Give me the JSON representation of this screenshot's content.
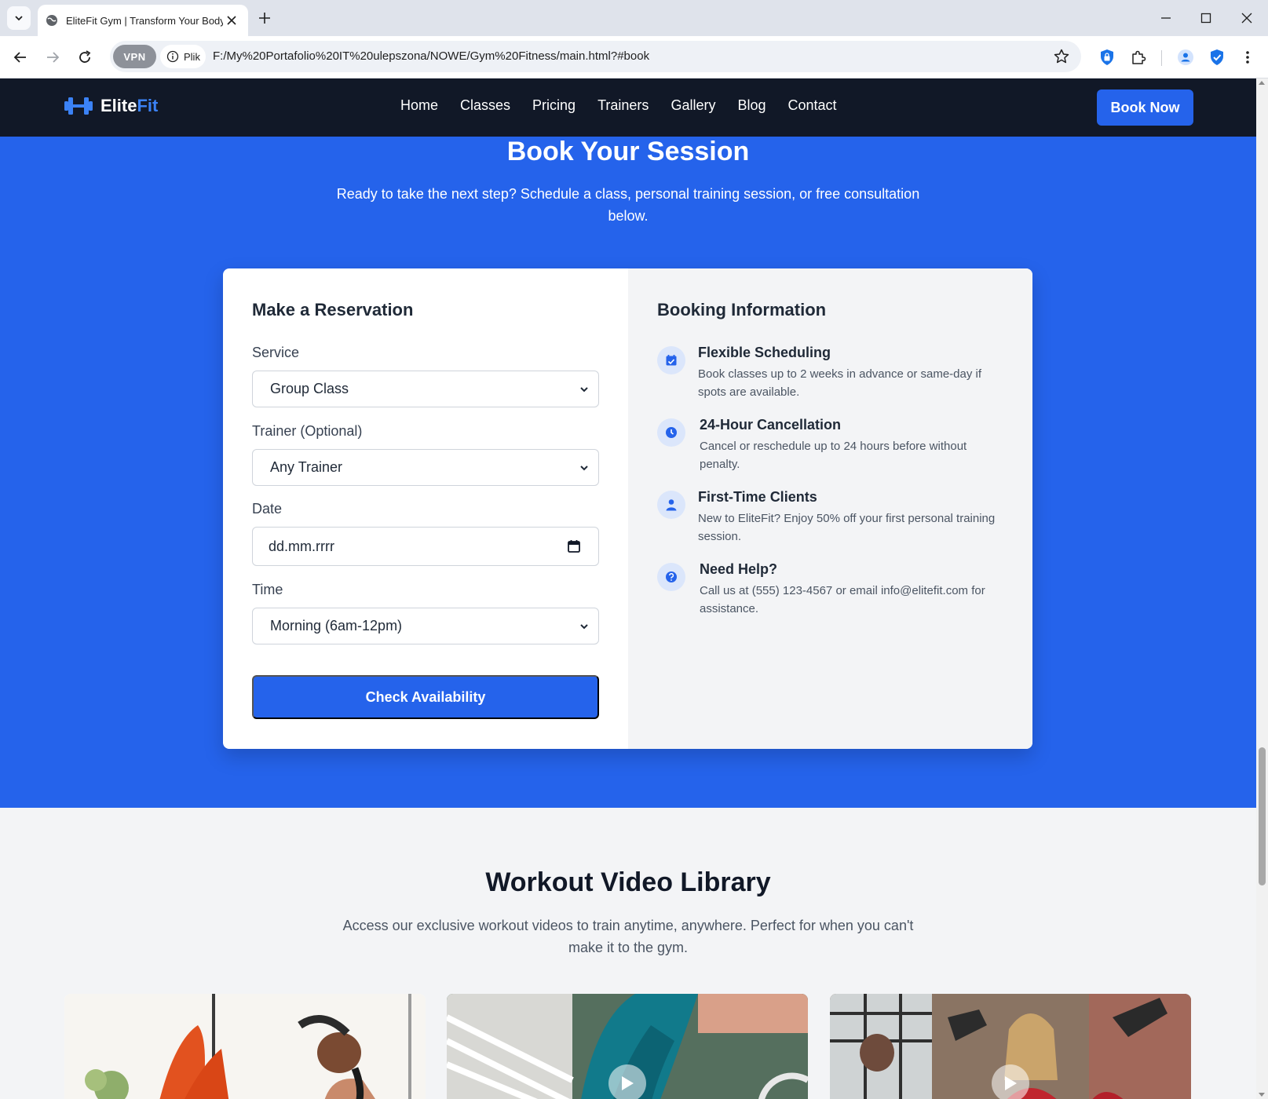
{
  "browser": {
    "tab_title": "EliteFit Gym | Transform Your Body",
    "vpn_label": "VPN",
    "site_info_label": "Plik",
    "url": "F:/My%20Portafolio%20IT%20ulepszona/NOWE/Gym%20Fitness/main.html?#book"
  },
  "nav": {
    "logo_main": "Elite",
    "logo_accent": "Fit",
    "links": [
      "Home",
      "Classes",
      "Pricing",
      "Trainers",
      "Gallery",
      "Blog",
      "Contact"
    ],
    "cta": "Book Now"
  },
  "booking": {
    "title": "Book Your Session",
    "subtitle": "Ready to take the next step? Schedule a class, personal training session, or free consultation below.",
    "form": {
      "title": "Make a Reservation",
      "service_label": "Service",
      "service_value": "Group Class",
      "trainer_label": "Trainer (Optional)",
      "trainer_value": "Any Trainer",
      "date_label": "Date",
      "date_placeholder": "dd.mm.rrrr",
      "time_label": "Time",
      "time_value": "Morning (6am-12pm)",
      "submit": "Check Availability"
    },
    "info": {
      "title": "Booking Information",
      "items": [
        {
          "icon": "calendar-check-icon",
          "title": "Flexible Scheduling",
          "text": "Book classes up to 2 weeks in advance or same-day if spots are available."
        },
        {
          "icon": "clock-icon",
          "title": "24-Hour Cancellation",
          "text": "Cancel or reschedule up to 24 hours before without penalty."
        },
        {
          "icon": "user-icon",
          "title": "First-Time Clients",
          "text": "New to EliteFit? Enjoy 50% off your first personal training session."
        },
        {
          "icon": "question-circle-icon",
          "title": "Need Help?",
          "text": "Call us at (555) 123-4567 or email info@elitefit.com for assistance."
        }
      ]
    }
  },
  "videos": {
    "title": "Workout Video Library",
    "subtitle": "Access our exclusive workout videos to train anytime, anywhere. Perfect for when you can't make it to the gym."
  },
  "colors": {
    "primary": "#2563eb",
    "nav_bg": "#111827",
    "light_bg": "#f3f4f6"
  }
}
